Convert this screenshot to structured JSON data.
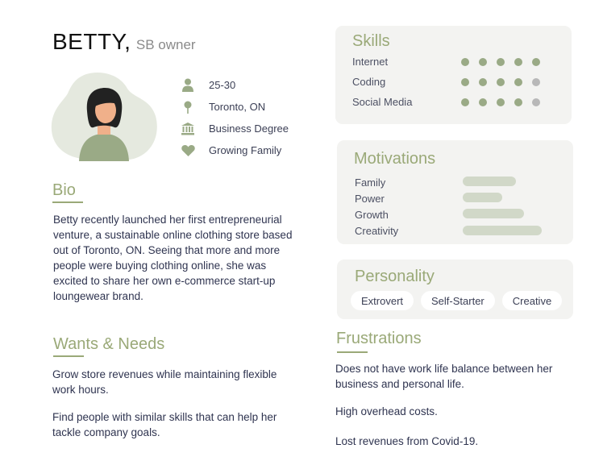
{
  "persona": {
    "name": "BETTY,",
    "role": "SB owner"
  },
  "facts": [
    {
      "icon": "person-icon",
      "text": "25-30"
    },
    {
      "icon": "location-pin-icon",
      "text": "Toronto, ON"
    },
    {
      "icon": "institution-icon",
      "text": "Business Degree"
    },
    {
      "icon": "heart-icon",
      "text": "Growing Family"
    }
  ],
  "bio": {
    "title": "Bio",
    "text": "Betty recently launched her first entrepreneurial venture, a sustainable online clothing store based out of Toronto, ON. Seeing that more and more people were buying clothing online, she was excited to share her own e-commerce start-up loungewear brand."
  },
  "wants": {
    "title": "Wants & Needs",
    "items": [
      "Grow store revenues while maintaining flexible work hours.",
      "Find people with similar skills that can help her tackle company goals."
    ]
  },
  "skills": {
    "title": "Skills",
    "items": [
      {
        "label": "Internet",
        "rating": 5,
        "max": 5
      },
      {
        "label": "Coding",
        "rating": 4,
        "max": 5
      },
      {
        "label": "Social Media",
        "rating": 4,
        "max": 5
      }
    ]
  },
  "motivations": {
    "title": "Motivations",
    "items": [
      {
        "label": "Family",
        "level": 0.28
      },
      {
        "label": "Power",
        "level": 0.21
      },
      {
        "label": "Growth",
        "level": 0.33
      },
      {
        "label": "Creativity",
        "level": 0.55
      }
    ]
  },
  "personality": {
    "title": "Personality",
    "tags": [
      "Extrovert",
      "Self-Starter",
      "Creative"
    ]
  },
  "frustrations": {
    "title": "Frustrations",
    "items": [
      "Does not have work life balance between her business and personal life.",
      "High overhead costs.",
      "Lost revenues from Covid-19."
    ]
  },
  "colors": {
    "accent": "#9aa978",
    "dot_filled": "#9aaa86",
    "dot_empty": "#b8b8b8",
    "bar": "#d1d8c8",
    "card": "#f3f3f1"
  }
}
